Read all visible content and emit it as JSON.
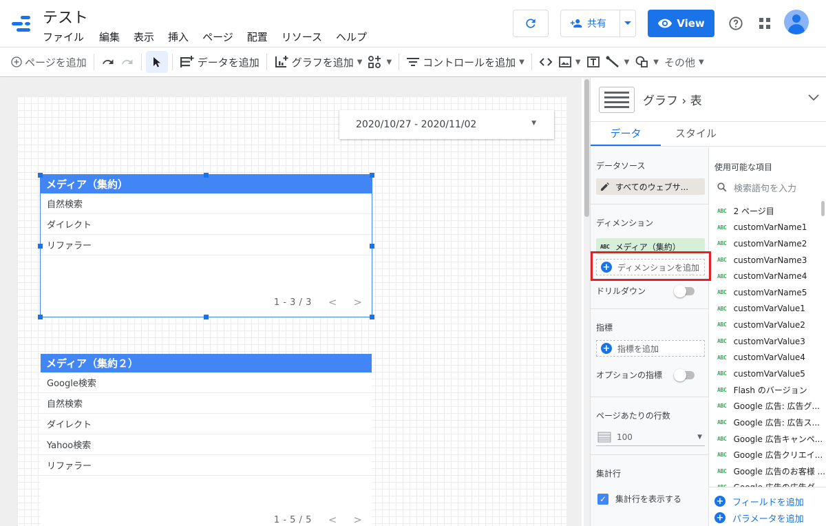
{
  "app": {
    "title": "テスト",
    "menu": [
      "ファイル",
      "編集",
      "表示",
      "挿入",
      "ページ",
      "配置",
      "リソース",
      "ヘルプ"
    ],
    "share_label": "共有",
    "view_label": "View"
  },
  "toolbar": {
    "add_page": "ページを追加",
    "add_data": "データを追加",
    "add_chart": "グラフを追加",
    "add_control": "コントロールを追加",
    "more": "その他"
  },
  "canvas": {
    "date_range": "2020/10/27 - 2020/11/02",
    "table1": {
      "header": "メディア（集約）",
      "rows": [
        "自然検索",
        "ダイレクト",
        "リファラー"
      ],
      "pager": "1 - 3 / 3"
    },
    "table2": {
      "header": "メディア（集約２）",
      "rows": [
        "Google検索",
        "自然検索",
        "ダイレクト",
        "Yahoo検索",
        "リファラー"
      ],
      "pager": "1 - 5 / 5"
    }
  },
  "panel": {
    "title": "グラフ › 表",
    "tabs": [
      "データ",
      "スタイル"
    ],
    "datasource_title": "データソース",
    "datasource_value": "すべてのウェブサ...",
    "dimension_title": "ディメンション",
    "dimension_type": "ABC",
    "dimension_value": "メディア（集約）",
    "add_dimension": "ディメンションを追加",
    "drilldown": "ドリルダウン",
    "metric_title": "指標",
    "add_metric": "指標を追加",
    "optional_metric": "オプションの指標",
    "rows_per_page_title": "ページあたりの行数",
    "rows_per_page_value": "100",
    "summary_title": "集計行",
    "summary_checkbox": "集計行を表示する",
    "fields_title": "使用可能な項目",
    "search_placeholder": "検索語句を入力",
    "field_type": "ABC",
    "fields": [
      "2 ページ目",
      "customVarName1",
      "customVarName2",
      "customVarName3",
      "customVarName4",
      "customVarName5",
      "customVarValue1",
      "customVarValue2",
      "customVarValue3",
      "customVarValue4",
      "customVarValue5",
      "Flash のバージョン",
      "Google 広告: 広告グ...",
      "Google 広告: 広告ス...",
      "Google 広告キャンペ...",
      "Google 広告クリエイ...",
      "Google 広告のお客様 ...",
      "Google 広告の広告グ..."
    ],
    "add_field": "フィールドを追加",
    "add_parameter": "パラメータを追加"
  },
  "colors": {
    "accent": "#1a73e8",
    "table_header": "#4285f4",
    "highlight": "#e3212b",
    "dimension_chip": "#d5efd8"
  }
}
